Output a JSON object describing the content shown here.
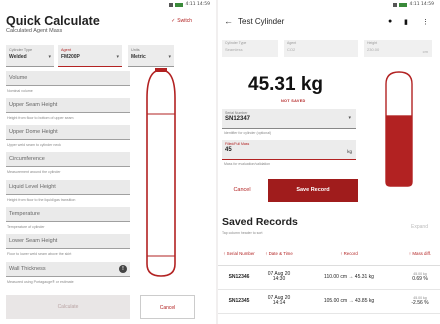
{
  "left": {
    "status": {
      "time": "4:11 14:59"
    },
    "title": "Quick Calculate",
    "subtitle": "Calculated Agent Mass",
    "switch_label": "Switch",
    "dropdowns": [
      {
        "label": "Cylinder Type",
        "value": "Welded"
      },
      {
        "label": "Agent",
        "value": "FM200P"
      },
      {
        "label": "Units",
        "value": "Metric"
      }
    ],
    "fields": [
      {
        "label": "Volume",
        "helper": "Nominal volume"
      },
      {
        "label": "Upper Seam Height",
        "helper": "Height from floor to bottom of upper seam"
      },
      {
        "label": "Upper Dome Height",
        "helper": "Upper weld seam to cylinder neck"
      },
      {
        "label": "Circumference",
        "helper": "Measurement around the cylinder"
      },
      {
        "label": "Liquid Level Height",
        "helper": "Height from floor to the liquid/gas transition"
      },
      {
        "label": "Temperature",
        "helper": "Temperature of cylinder"
      },
      {
        "label": "Lower Seam Height",
        "helper": "Floor to lower weld seam above the skirt"
      },
      {
        "label": "Wall Thickness",
        "helper": "Measured using Portagauge® or estimate"
      }
    ],
    "calc_button": "Calculate",
    "cancel_button": "Cancel"
  },
  "right": {
    "status": {
      "time": "4:11 14:59"
    },
    "title": "Test Cylinder",
    "top_fields": [
      {
        "label": "Cylinder Type",
        "value": "Seamless"
      },
      {
        "label": "Agent",
        "value": "CO2"
      },
      {
        "label": "Height",
        "value": "230.00",
        "unit": "cm"
      }
    ],
    "mass_value": "45.31 kg",
    "not_saved": "NOT SAVED",
    "serial": {
      "label": "Serial Number",
      "value": "SN12347",
      "helper": "Identifier for cylinder (optional)"
    },
    "filled_mass": {
      "label": "Filled/Full Mass",
      "value": "45",
      "unit": "kg",
      "helper": "Mass for evaluation/validation"
    },
    "cancel_button": "Cancel",
    "save_button": "Save Record",
    "fill_fraction": 0.62,
    "saved_title": "Saved Records",
    "saved_sub": "Tap column header to sort",
    "expand": "Expand",
    "table_headers": [
      "Serial Number",
      "Date & Time",
      "Record",
      "Mass diff."
    ],
    "records": [
      {
        "serial": "SN12346",
        "date": "07 Aug 20",
        "time": "14:30",
        "record": "110.00 cm → 45.31 kg",
        "mass_small": "45.00 kg",
        "mass": "0.69 %"
      },
      {
        "serial": "SN12345",
        "date": "07 Aug 20",
        "time": "14:14",
        "record": "105.00 cm → 43.85 kg",
        "mass_small": "45.00 kg",
        "mass": "-2.56 %"
      }
    ]
  },
  "colors": {
    "accent": "#a01c1c",
    "field_bg": "#ececec"
  }
}
